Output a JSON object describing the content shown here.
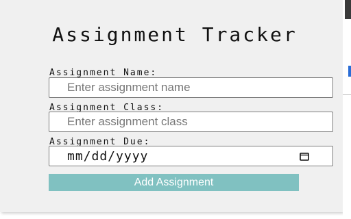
{
  "app": {
    "title": "Assignment Tracker"
  },
  "form": {
    "name_label": "Assignment Name:",
    "name_placeholder": "Enter assignment name",
    "class_label": "Assignment Class:",
    "class_placeholder": "Enter assignment class",
    "due_label": "Assignment Due:",
    "due_placeholder": "mm/dd/yyyy",
    "add_button_label": "Add Assignment"
  },
  "icons": {
    "calendar": "calendar-icon"
  },
  "colors": {
    "button_bg": "#80c1c1",
    "button_text": "#ffffff",
    "panel_bg": "#f0f0f0"
  }
}
